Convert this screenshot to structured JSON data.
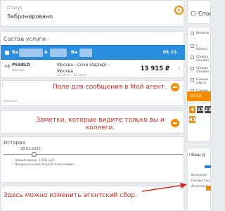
{
  "status": {
    "caption": "Статус",
    "value": "Забронировано"
  },
  "services": {
    "title": "Состав услуги",
    "passenger": {
      "name_start": "Ба",
      "name_mid1": "А",
      "name_mid2": "Ва",
      "date": "05.10."
    },
    "flight": {
      "number": "PS58LO",
      "sub": "Эконом",
      "route": "Москва - Сочи (Адлер) -",
      "city": "Москва",
      "date": "13 октя. , 25 октя.",
      "price": "13 915 ₽"
    }
  },
  "message_block": {
    "annotation": "Поле для сообщения в Мой агент.",
    "link": "запросы"
  },
  "notes_block": {
    "annotation": "Заметки, которые видите только вы и коллеги."
  },
  "history": {
    "title": "История",
    "event_date": "28.02.2022",
    "event_line1": "Новый доход: 1 501 руб",
    "event_line2": "Воскресенский Андрей Алексеевич"
  },
  "bottom": {
    "annotation": "Здесь можно изменить агентский сбор."
  },
  "sidebar": {
    "title": "Спос",
    "options": [
      {
        "label": "Включи"
      },
      {
        "label": "С баланс"
      },
      {
        "label": "Сберба Онлайн"
      },
      {
        "label": "Сберба Онлайн"
      },
      {
        "label": "Банков карта"
      },
      {
        "label": "Сохран способ"
      }
    ],
    "pay_button": "Опла",
    "timer": [
      "4",
      "23",
      "23",
      "41"
    ],
    "agent_title": "Ваш д",
    "agent_lines": [
      "Вознагра",
      "Предустан",
      "Агентский"
    ]
  },
  "colors": {
    "accent": "#f28c00",
    "selection": "#2a8ee0",
    "annotation": "#d52b1e"
  }
}
